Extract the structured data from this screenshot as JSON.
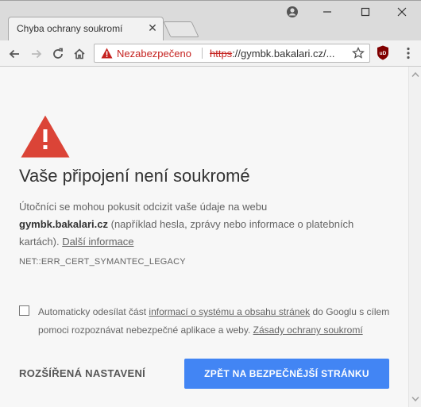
{
  "tab": {
    "title": "Chyba ochrany soukromí"
  },
  "omnibox": {
    "security_label": "Nezabezpečeno",
    "url_scheme": "https",
    "url_rest": "://gymbk.bakalari.cz/..."
  },
  "extension": {
    "badge": "uD"
  },
  "interstitial": {
    "heading": "Vaše připojení není soukromé",
    "para_1": "Útočníci se mohou pokusit odcizit vaše údaje na webu",
    "host": "gymbk.bakalari.cz",
    "para_2": " (například hesla, zprávy nebo informace o platebních kartách). ",
    "learn_more": "Další informace",
    "error_code": "NET::ERR_CERT_SYMANTEC_LEGACY",
    "checkbox_text_1": "Automaticky odesílat část ",
    "checkbox_link_1": "informací o systému a obsahu stránek",
    "checkbox_text_2": " do Googlu s cílem pomoci rozpoznávat nebezpečné aplikace a weby. ",
    "checkbox_link_2": "Zásady ochrany soukromí",
    "details_button": "ROZŠÍŘENÁ NASTAVENÍ",
    "back_button": "ZPĚT NA BEZPEČNĚJŠÍ STRÁNKU"
  },
  "colors": {
    "warning_red": "#db4437",
    "primary_blue": "#4285f4",
    "insecure_red": "#c5221f"
  }
}
